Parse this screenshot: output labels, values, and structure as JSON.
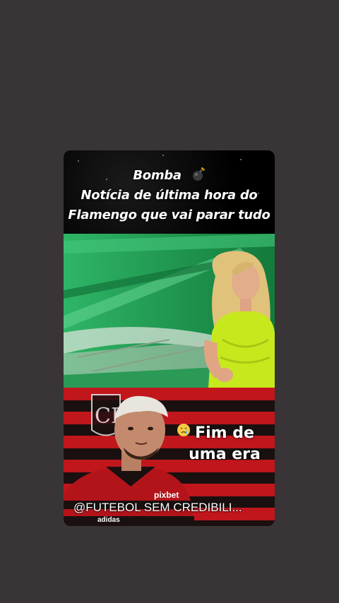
{
  "story": {
    "caption_line1": "Bomba",
    "caption_line2": "Notícia de última hora do",
    "caption_line3": "Flamengo que vai parar tudo",
    "bomb_icon": "bomb-emoji",
    "headline_line1": "Fim de",
    "headline_line2": "uma era",
    "cry_icon": "crying-face-emoji",
    "watermark": "@FUTEBOL SEM CREDIBILI...",
    "jersey_sponsor": "pixbet",
    "jersey_brand": "adidas"
  },
  "colors": {
    "background": "#393536",
    "studio_green": "#1f8c4e",
    "flamengo_red": "#c0161c",
    "flamengo_black": "#1a1010",
    "presenter_dress": "#c8e81e"
  }
}
